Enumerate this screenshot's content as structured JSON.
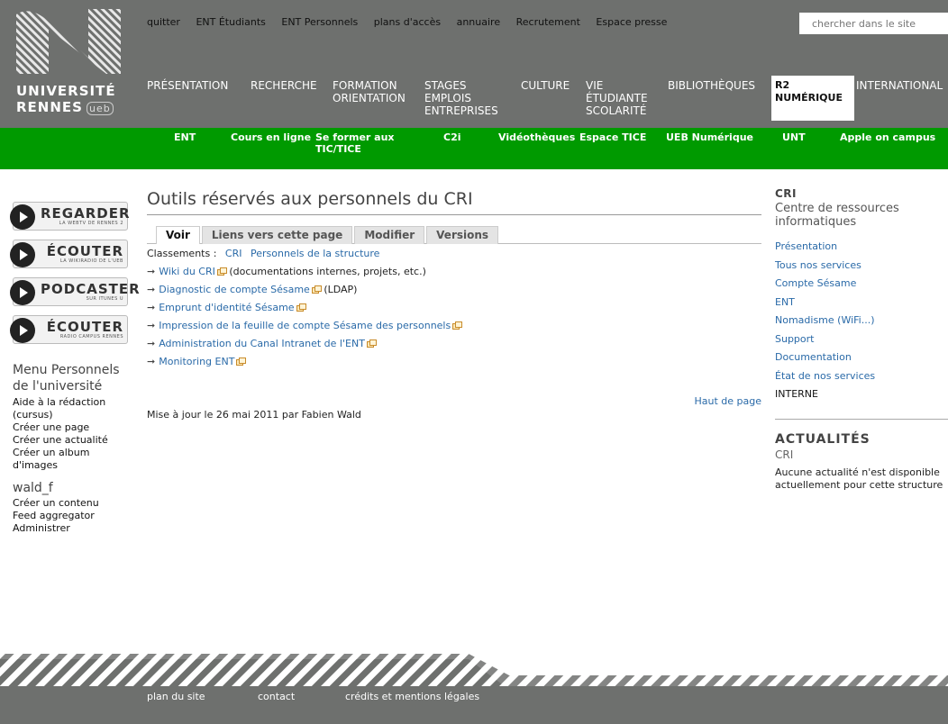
{
  "header": {
    "logo_line1": "UNIVERSITÉ",
    "logo_line2": "RENNES",
    "logo_ueb": "ueb",
    "top_links": [
      "quitter",
      "ENT Étudiants",
      "ENT Personnels",
      "plans d'accès",
      "annuaire",
      "Recrutement",
      "Espace presse"
    ],
    "search_placeholder": "chercher dans le site"
  },
  "main_nav": [
    "PRÉSENTATION",
    "RECHERCHE",
    "FORMATION ORIENTATION",
    "STAGES EMPLOIS ENTREPRISES",
    "CULTURE",
    "VIE ÉTUDIANTE SCOLARITÉ",
    "BIBLIOTHÈQUES",
    "R2 NUMÉRIQUE",
    "INTERNATIONAL"
  ],
  "green_nav": [
    "ENT",
    "Cours en ligne",
    "Se former aux TIC/TICE",
    "C2i",
    "Vidéothèques",
    "Espace TICE",
    "UEB Numérique",
    "UNT",
    "Apple on campus"
  ],
  "media_buttons": [
    {
      "label": "REGARDER",
      "sub": "LA WEBTV DE RENNES 2"
    },
    {
      "label": "ÉCOUTER",
      "sub": "LA WIKIRADIO DE L'UEB"
    },
    {
      "label": "PODCASTER",
      "sub": "SUR ITUNES U"
    },
    {
      "label": "ÉCOUTER",
      "sub": "RADIO CAMPUS RENNES"
    }
  ],
  "left_menu": {
    "heading": "Menu Personnels de l'université",
    "items": [
      "Aide à la rédaction (cursus)",
      "Créer une page",
      "Créer une actualité",
      "Créer un album d'images"
    ],
    "user": "wald_f",
    "user_items": [
      "Créer un contenu",
      "Feed aggregator",
      "Administrer"
    ]
  },
  "main": {
    "title": "Outils réservés aux personnels du CRI",
    "tabs": [
      "Voir",
      "Liens vers cette page",
      "Modifier",
      "Versions"
    ],
    "classements_label": "Classements :",
    "classements": [
      "CRI",
      "Personnels de la structure"
    ],
    "links": [
      {
        "text": "Wiki du CRI",
        "suffix": "(documentations internes, projets, etc.)"
      },
      {
        "text": "Diagnostic de compte Sésame",
        "suffix": "(LDAP)"
      },
      {
        "text": "Emprunt d'identité Sésame",
        "suffix": ""
      },
      {
        "text": "Impression de la feuille de compte Sésame des personnels",
        "suffix": ""
      },
      {
        "text": "Administration du Canal Intranet de l'ENT",
        "suffix": ""
      },
      {
        "text": "Monitoring ENT",
        "suffix": ""
      }
    ],
    "top_link": "Haut de page",
    "update": "Mise à jour le 26 mai 2011 par Fabien Wald"
  },
  "right": {
    "head": "CRI",
    "sub": "Centre de ressources informatiques",
    "items": [
      "Présentation",
      "Tous nos services",
      "Compte Sésame",
      "ENT",
      "Nomadisme (WiFi...)",
      "Support",
      "Documentation",
      "État de nos services",
      "INTERNE"
    ],
    "actus_head": "ACTUALITÉS",
    "actus_sub": "CRI",
    "actus_text": "Aucune actualité n'est disponible actuellement pour cette structure"
  },
  "footer": [
    "plan du site",
    "contact",
    "crédits et mentions légales"
  ],
  "colors": {
    "header_gray": "#6e706e",
    "green": "#009a00",
    "link": "#2a6aa8"
  }
}
